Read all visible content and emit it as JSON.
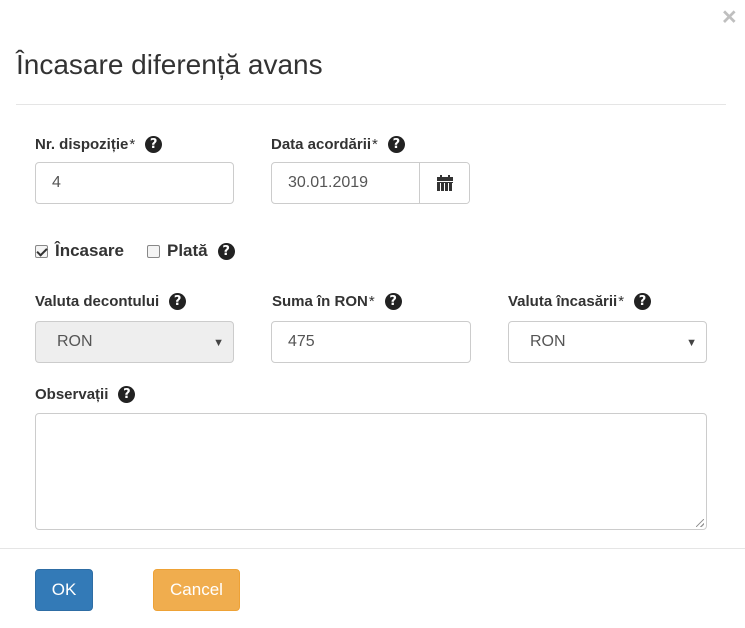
{
  "dialog": {
    "title": "Încasare diferență avans",
    "close_glyph": "×"
  },
  "fields": {
    "nr_dispozitie": {
      "label": "Nr. dispoziție",
      "required_mark": "*",
      "value": "4"
    },
    "data_acordarii": {
      "label": "Data acordării",
      "required_mark": "*",
      "value": "30.01.2019",
      "button_icon": "calendar-icon"
    },
    "valuta_decontului": {
      "label": "Valuta decontului",
      "value": "RON",
      "disabled": true
    },
    "suma_ron": {
      "label": "Suma în RON",
      "required_mark": "*",
      "value": "475"
    },
    "valuta_incasarii": {
      "label": "Valuta încasării",
      "required_mark": "*",
      "value": "RON"
    },
    "observatii": {
      "label": "Observații",
      "value": ""
    }
  },
  "type_options": [
    {
      "label": "Încasare",
      "checked": true
    },
    {
      "label": "Plată",
      "checked": false
    }
  ],
  "help_glyph": "?",
  "select_arrow": "▼",
  "buttons": {
    "ok": "OK",
    "cancel": "Cancel"
  },
  "colors": {
    "primary": "#337ab7",
    "warning": "#f0ad4e",
    "disabled_bg": "#eeeeee",
    "border": "#cccccc"
  }
}
